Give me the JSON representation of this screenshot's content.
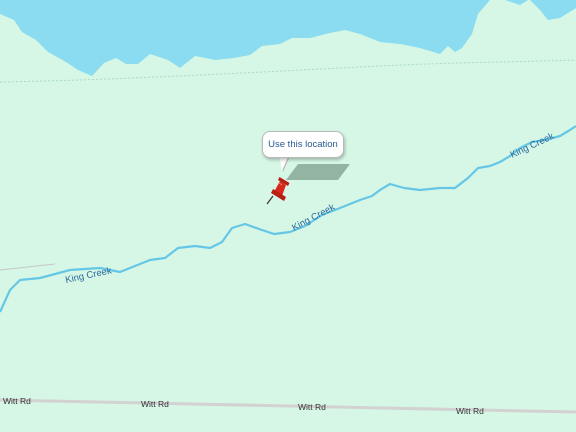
{
  "map": {
    "water_color": "#8bdcf0",
    "land_color": "#d6f7e6",
    "creek_color": "#66c6e6",
    "road_color": "#d2d2d2",
    "creek_label_color": "#2a6a9c",
    "road_label_color": "#333333",
    "pin_color": "#d8281c"
  },
  "callout": {
    "label": "Use this location"
  },
  "creek_labels": [
    {
      "text": "King Creek"
    },
    {
      "text": "King Creek"
    },
    {
      "text": "King Creek"
    }
  ],
  "road_labels": [
    {
      "text": "Witt Rd"
    },
    {
      "text": "Witt Rd"
    },
    {
      "text": "Witt Rd"
    },
    {
      "text": "Witt Rd"
    }
  ],
  "icons": {
    "pin": "pushpin-icon"
  }
}
